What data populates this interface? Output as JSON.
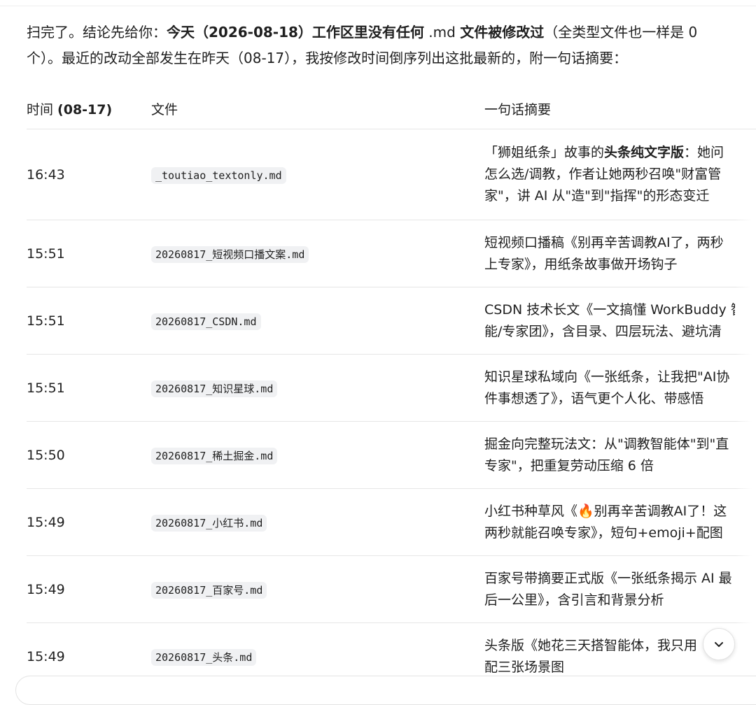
{
  "intro": {
    "p1": "扫完了。结论先给你：",
    "b1": "今天（2026-08-18）工作区里没有任何",
    "code": ".md",
    "b2": "文件被修改过",
    "p2": "（全类型文件也一样是 0 个）。最近的改动全部发生在昨天（08-17），我按修改时间倒序列出这批最新的，附一句话摘要："
  },
  "table": {
    "headers": {
      "time_prefix": "时间 ",
      "time_bold": "(08-17)",
      "file": "文件",
      "summary": "一句话摘要"
    },
    "rows": [
      {
        "time": "16:43",
        "file": "_toutiao_textonly.md",
        "sum": [
          [
            "「狮姐纸条」故事的",
            "头条纯文字版",
            "：她问"
          ],
          [
            "怎么选/调教，作者让她两秒召唤\"财富管",
            "",
            ""
          ],
          [
            "家\"，讲 AI 从\"造\"到\"指挥\"的形态变迁",
            "",
            ""
          ]
        ]
      },
      {
        "time": "15:51",
        "file": "20260817_短视频口播文案.md",
        "sum": [
          [
            "短视频口播稿《别再辛苦调教AI了，两秒",
            "",
            ""
          ],
          [
            "上专家》，用纸条故事做开场钩子",
            "",
            ""
          ]
        ]
      },
      {
        "time": "15:51",
        "file": "20260817_CSDN.md",
        "sum": [
          [
            "CSDN 技术长文《一文搞懂 WorkBuddy 智",
            "",
            ""
          ],
          [
            "能/专家团》，含目录、四层玩法、避坑清",
            "",
            ""
          ]
        ]
      },
      {
        "time": "15:51",
        "file": "20260817_知识星球.md",
        "sum": [
          [
            "知识星球私域向《一张纸条，让我把\"AI协",
            "",
            ""
          ],
          [
            "件事想透了》，语气更个人化、带感悟",
            "",
            ""
          ]
        ]
      },
      {
        "time": "15:50",
        "file": "20260817_稀土掘金.md",
        "sum": [
          [
            "掘金向完整玩法文：从\"调教智能体\"到\"直",
            "",
            ""
          ],
          [
            "专家\"，把重复劳动压缩 6 倍",
            "",
            ""
          ]
        ]
      },
      {
        "time": "15:49",
        "file": "20260817_小红书.md",
        "sum": [
          [
            "小红书种草风《🔥别再辛苦调教AI了！这",
            "",
            ""
          ],
          [
            "两秒就能召唤专家》，短句+emoji+配图",
            "",
            ""
          ]
        ]
      },
      {
        "time": "15:49",
        "file": "20260817_百家号.md",
        "sum": [
          [
            "百家号带摘要正式版《一张纸条揭示 AI 最",
            "",
            ""
          ],
          [
            "后一公里》，含引言和背景分析",
            "",
            ""
          ]
        ]
      },
      {
        "time": "15:49",
        "file": "20260817_头条.md",
        "sum": [
          [
            "头条版《她花三天搭智能体，我只用",
            "",
            ""
          ],
          [
            "配三张场景图",
            "",
            ""
          ]
        ]
      }
    ]
  },
  "icons": {
    "scroll": "chevron-down-icon"
  }
}
